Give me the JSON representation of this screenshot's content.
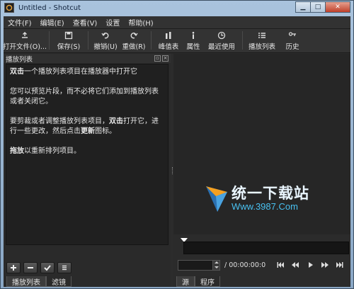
{
  "window": {
    "title": "Untitled - Shotcut",
    "controls": [
      "minimize",
      "maximize",
      "close"
    ]
  },
  "menu": [
    "文件(F)",
    "编辑(E)",
    "查看(V)",
    "设置",
    "帮助(H)"
  ],
  "toolbar": {
    "open_file": "打开文件(O)...",
    "save": "保存(S)",
    "undo": "撤销(U)",
    "redo": "重做(R)",
    "peak_meter": "峰值表",
    "properties": "属性",
    "recent": "最近使用",
    "playlist": "播放列表",
    "history": "历史"
  },
  "playlist_panel": {
    "title": "播放列表",
    "help": {
      "p1_bold": "双击",
      "p1_rest": "一个播放列表项目在播放器中打开它",
      "p2": "您可以预览片段，而不必将它们添加到播放列表或者关闭它。",
      "p3_a": "要剪裁或者调整播放列表项目，",
      "p3_bold1": "双击",
      "p3_b": "打开它，进行一些更改，然后点击",
      "p3_bold2": "更新",
      "p3_c": "图标。",
      "p4_bold": "拖放",
      "p4_rest": "以重新排列项目。"
    },
    "actions": [
      "add",
      "remove",
      "update",
      "menu"
    ],
    "tabs": [
      "播放列表",
      "滤镜"
    ]
  },
  "viewer": {
    "watermark_cn": "统一下载站",
    "watermark_url": "Www.3987.Com",
    "duration": "/ 00:00:00:0",
    "position_value": "",
    "transport": [
      "skip-to-start",
      "rewind",
      "play",
      "fast-forward",
      "skip-to-end"
    ],
    "tabs": [
      "源",
      "程序"
    ]
  },
  "colors": {
    "background": "#2b2b2b",
    "watermark_blue": "#48c0f0",
    "logo_orange": "#f5a020"
  }
}
